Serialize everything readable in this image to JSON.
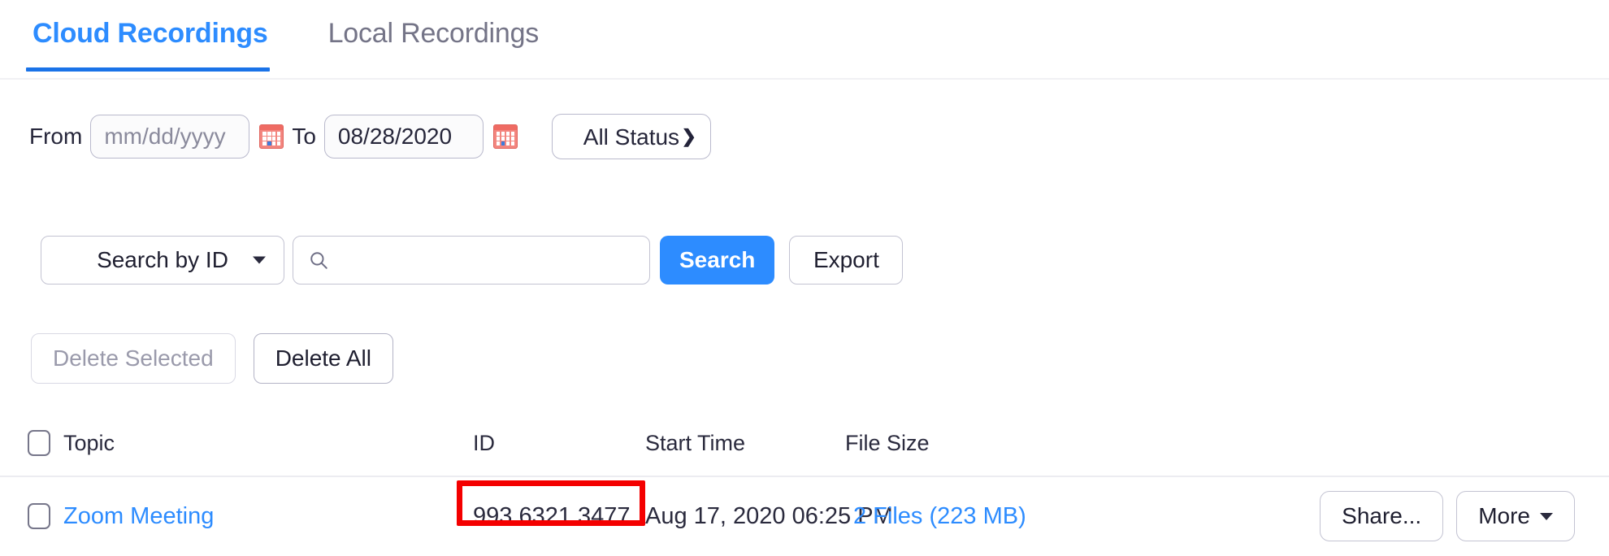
{
  "colors": {
    "accent_blue": "#2d8cff",
    "tab_underline": "#1a73e8",
    "annotation_red": "#f40000",
    "text_dark": "#2a2a3d",
    "text_muted": "#747487",
    "disabled_text": "#9a9aab",
    "border": "#c3c3d2"
  },
  "tabs": [
    {
      "label": "Cloud Recordings",
      "active": true
    },
    {
      "label": "Local Recordings",
      "active": false
    }
  ],
  "filters": {
    "from_label": "From",
    "from_value": "",
    "from_placeholder": "mm/dd/yyyy",
    "to_label": "To",
    "to_value": "08/28/2020",
    "to_placeholder": "mm/dd/yyyy",
    "from_calendar_icon": "calendar-icon",
    "to_calendar_icon": "calendar-icon",
    "status_selected": "All Status",
    "status_caret_icon": "chevron-down-icon"
  },
  "search": {
    "search_by_label": "Search by  ID",
    "search_by_caret_icon": "triangle-down-icon",
    "input_value": "",
    "input_placeholder": "",
    "magnifier_icon": "search-icon",
    "search_button": "Search",
    "export_button": "Export"
  },
  "bulk_actions": {
    "delete_selected": "Delete Selected",
    "delete_selected_disabled": true,
    "delete_all": "Delete All"
  },
  "table": {
    "headers": {
      "select_all_checkbox": "select-all-checkbox",
      "topic": "Topic",
      "id": "ID",
      "start_time": "Start Time",
      "file_size": "File Size"
    },
    "rows": [
      {
        "checkbox": "row-checkbox",
        "topic": "Zoom Meeting",
        "id": "993 6321 3477",
        "id_annotated": true,
        "start_time": "Aug 17, 2020 06:25 PM",
        "file_size": "2 Files (223 MB)",
        "share_button": "Share...",
        "more_button": "More",
        "more_caret_icon": "triangle-down-icon"
      }
    ]
  }
}
